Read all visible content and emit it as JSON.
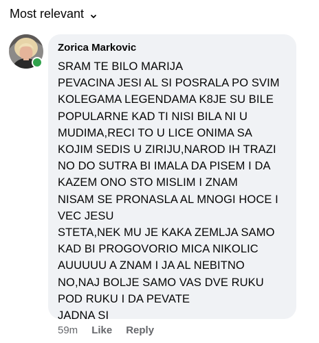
{
  "sort": {
    "label": "Most relevant"
  },
  "comment": {
    "author": "Zorica Markovic",
    "lines": [
      "SRAM TE BILO MARIJA",
      "PEVACINA JESI AL SI POSRALA PO SVIM",
      "KOLEGAMA LEGENDAMA K8JE SU BILE",
      "POPULARNE KAD TI NISI BILA NI U",
      "MUDIMA,RECI TO U LICE ONIMA SA",
      "KOJIM SEDIS U ZIRIJU,NAROD IH TRAZI",
      "NO DO SUTRA BI IMALA DA PISEM I DA",
      "KAZEM ONO STO MISLIM I ZNAM",
      "NISAM SE PRONASLA AL MNOGI HOCE I",
      "VEC JESU",
      "STETA,NEK MU JE KAKA ZEMLJA SAMO",
      "KAD BI PROGOVORIO MICA NIKOLIC",
      "AUUUUU A ZNAM I JA AL NEBITNO",
      "NO,NAJ BOLJE SAMO VAS DVE RUKU",
      "POD RUKU I DA PEVATE",
      "JADNA SI"
    ],
    "time": "59m",
    "like_label": "Like",
    "reply_label": "Reply",
    "online": true
  },
  "colors": {
    "bubble": "#f0f2f5",
    "online": "#31a24c",
    "meta_text": "#65676b"
  },
  "icons": {
    "sort": "chevron-down-icon",
    "status": "online-status-icon"
  }
}
